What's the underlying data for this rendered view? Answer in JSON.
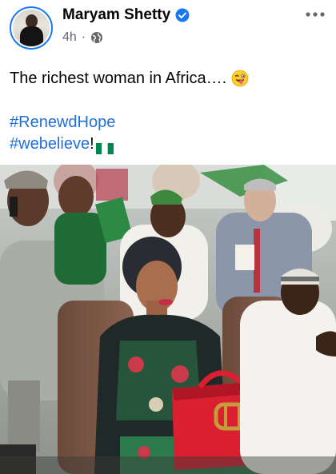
{
  "post": {
    "author": "Maryam Shetty",
    "time": "4h",
    "separator": "·",
    "text": "The richest woman in Africa….",
    "hashtags": [
      "#RenewdHope",
      "#webelieve"
    ],
    "hashtag_suffix": "!"
  },
  "icons": {
    "verified": "verified-badge-icon",
    "audience": "globe-icon",
    "more": "more-options-icon",
    "emoji": "winking-tongue-emoji-icon",
    "flag": "nigeria-flag-icon"
  },
  "colors": {
    "link": "#216fdb",
    "verified": "#1877f2",
    "meta": "#65676b",
    "flag_green": "#008751"
  }
}
